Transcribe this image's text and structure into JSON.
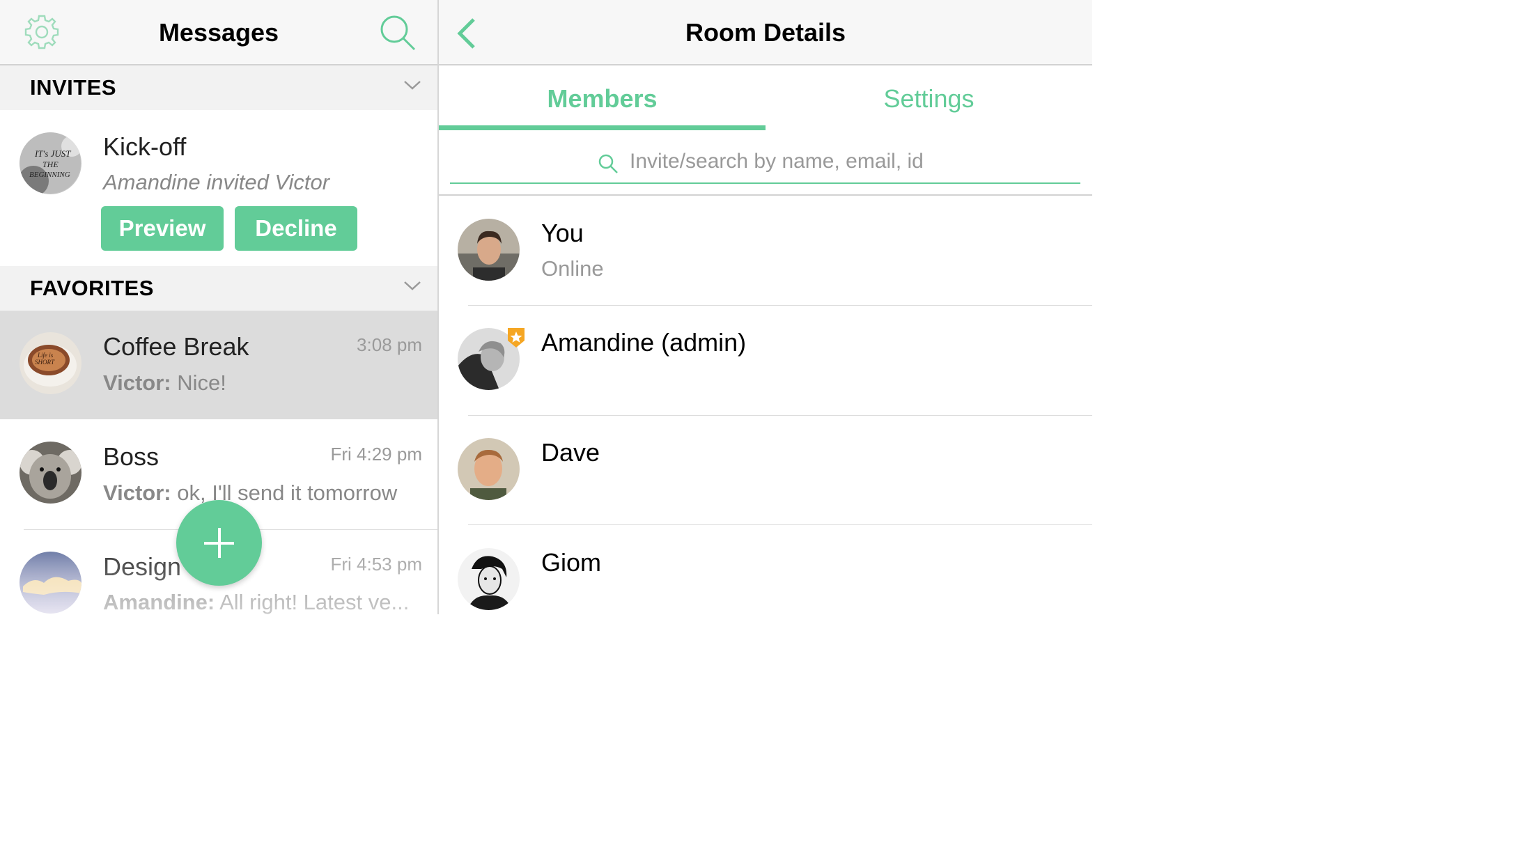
{
  "left": {
    "title": "Messages",
    "sections": {
      "invites": "INVITES",
      "favorites": "FAVORITES"
    },
    "invite": {
      "room": "Kick-off",
      "preview": "Amandine invited Victor",
      "preview_button": "Preview",
      "decline_button": "Decline"
    },
    "rooms": [
      {
        "name": "Coffee Break",
        "time": "3:08 pm",
        "sender": "Victor:",
        "message": " Nice!"
      },
      {
        "name": "Boss",
        "time": "Fri 4:29 pm",
        "sender": "Victor:",
        "message": " ok, I'll send it tomorrow"
      },
      {
        "name": "Design",
        "time": "Fri 4:53 pm",
        "sender": "Amandine:",
        "message": " All right! Latest ve..."
      }
    ]
  },
  "right": {
    "title": "Room Details",
    "tabs": [
      "Members",
      "Settings"
    ],
    "search_placeholder": "Invite/search by name, email, id",
    "members": [
      {
        "name": "You",
        "status": "Online"
      },
      {
        "name": "Amandine (admin)",
        "status": ""
      },
      {
        "name": "Dave",
        "status": ""
      },
      {
        "name": "Giom",
        "status": ""
      }
    ]
  },
  "colors": {
    "accent": "#62cc98",
    "selected_row": "#dcdcdc",
    "admin_badge": "#f5a623"
  }
}
